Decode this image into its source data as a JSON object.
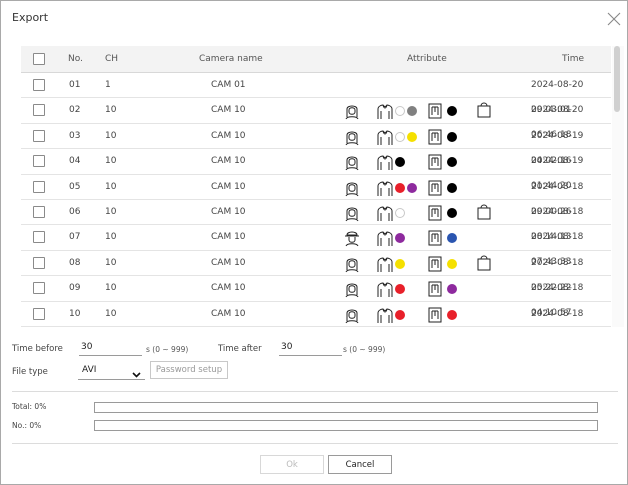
{
  "dialog": {
    "title": "Export"
  },
  "table": {
    "columns": {
      "no": "No.",
      "ch": "CH",
      "camera": "Camera name",
      "attribute": "Attribute",
      "time": "Time"
    },
    "rows": [
      {
        "no": "01",
        "ch": "1",
        "camera": "CAM 01",
        "time": "2024-08-20 09:03:01",
        "face": false,
        "person": false,
        "top_colors": [],
        "bottom_colors": [],
        "bag": false
      },
      {
        "no": "02",
        "ch": "10",
        "camera": "CAM 10",
        "time": "2024-08-20 06:46:18",
        "face": true,
        "person": true,
        "top_colors": [
          "#ffffff",
          "#808080"
        ],
        "bottom_colors": [
          "#000000"
        ],
        "bag": true
      },
      {
        "no": "03",
        "ch": "10",
        "camera": "CAM 10",
        "time": "2024-08-19 04:02:16",
        "face": true,
        "person": true,
        "top_colors": [
          "#ffffff",
          "#f5e000"
        ],
        "bottom_colors": [
          "#000000"
        ],
        "bag": false
      },
      {
        "no": "04",
        "ch": "10",
        "camera": "CAM 10",
        "time": "2024-08-19 01:44:20",
        "face": true,
        "person": true,
        "top_colors": [
          "#000000"
        ],
        "bottom_colors": [
          "#000000"
        ],
        "bag": false
      },
      {
        "no": "05",
        "ch": "10",
        "camera": "CAM 10",
        "time": "2024-08-18 09:00:26",
        "face": true,
        "person": true,
        "top_colors": [
          "#e8202a",
          "#8e2a9e"
        ],
        "bottom_colors": [
          "#000000"
        ],
        "bag": false
      },
      {
        "no": "06",
        "ch": "10",
        "camera": "CAM 10",
        "time": "2024-08-18 08:14:13",
        "face": true,
        "person": true,
        "top_colors": [
          "#ffffff"
        ],
        "bottom_colors": [
          "#000000"
        ],
        "bag": true
      },
      {
        "no": "07",
        "ch": "10",
        "camera": "CAM 10",
        "time": "2024-08-18 07:43:33",
        "face": "hat",
        "person": true,
        "top_colors": [
          "#8e2a9e"
        ],
        "bottom_colors": [
          "#2a55b0"
        ],
        "bag": false
      },
      {
        "no": "08",
        "ch": "10",
        "camera": "CAM 10",
        "time": "2024-08-18 05:22:22",
        "face": true,
        "person": true,
        "top_colors": [
          "#f5e000"
        ],
        "bottom_colors": [
          "#f5e000"
        ],
        "bag": true
      },
      {
        "no": "09",
        "ch": "10",
        "camera": "CAM 10",
        "time": "2024-08-18 04:10:57",
        "face": true,
        "person": true,
        "top_colors": [
          "#e8202a"
        ],
        "bottom_colors": [
          "#8e2a9e"
        ],
        "bag": false
      },
      {
        "no": "10",
        "ch": "10",
        "camera": "CAM 10",
        "time": "2024-08-18 04:09:52",
        "face": true,
        "person": true,
        "top_colors": [
          "#e8202a"
        ],
        "bottom_colors": [
          "#e8202a"
        ],
        "bag": false
      }
    ]
  },
  "settings": {
    "time_before_label": "Time before",
    "time_before_value": "30",
    "time_before_range": "s (0 ~ 999)",
    "time_after_label": "Time after",
    "time_after_value": "30",
    "time_after_range": "s (0 ~ 999)",
    "file_type_label": "File type",
    "file_type_value": "AVI",
    "password_button": "Password setup"
  },
  "progress": {
    "total_label": "Total: 0%",
    "total_value": 0,
    "no_label": "No.: 0%",
    "no_value": 0
  },
  "footer": {
    "ok_label": "Ok",
    "cancel_label": "Cancel"
  },
  "icons": {
    "close": "close-icon",
    "face": "face-icon",
    "hat": "hat-face-icon",
    "person": "upper-body-icon",
    "bottom": "lower-body-icon",
    "bag": "bag-icon",
    "dropdown": "chevron-down-icon"
  }
}
